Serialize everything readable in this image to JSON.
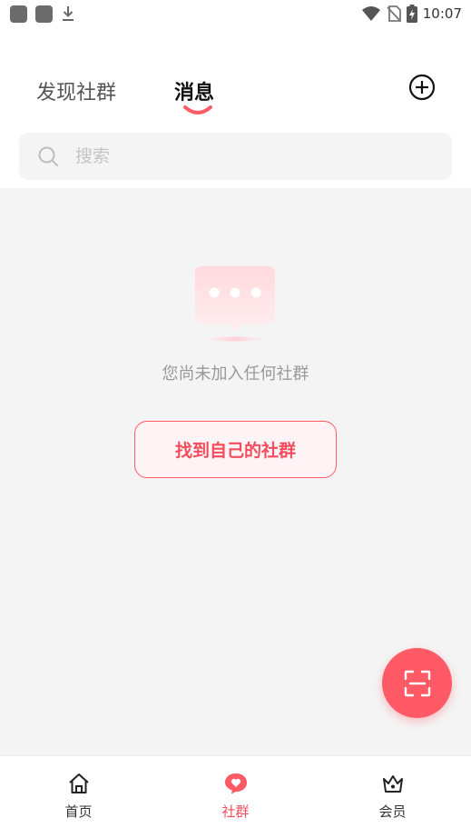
{
  "status_bar": {
    "time": "10:07",
    "icons": [
      "app-square-icon",
      "app-square-icon",
      "download-icon",
      "wifi-icon",
      "no-sim-icon",
      "battery-charging-icon"
    ]
  },
  "tabs": [
    {
      "label": "发现社群",
      "active": false
    },
    {
      "label": "消息",
      "active": true
    }
  ],
  "header": {
    "add_icon": "plus-circle-icon"
  },
  "search": {
    "placeholder": "搜索",
    "value": ""
  },
  "empty_state": {
    "message": "您尚未加入任何社群",
    "button_label": "找到自己的社群",
    "illustration": "chat-bubble-icon"
  },
  "fab": {
    "icon": "scan-icon"
  },
  "bottom_nav": [
    {
      "label": "首页",
      "icon": "home-icon",
      "active": false
    },
    {
      "label": "社群",
      "icon": "community-heart-icon",
      "active": true
    },
    {
      "label": "会员",
      "icon": "crown-icon",
      "active": false
    }
  ],
  "colors": {
    "accent": "#ff5a66",
    "accent_text": "#f24d5c",
    "background": "#f4f4f4"
  }
}
